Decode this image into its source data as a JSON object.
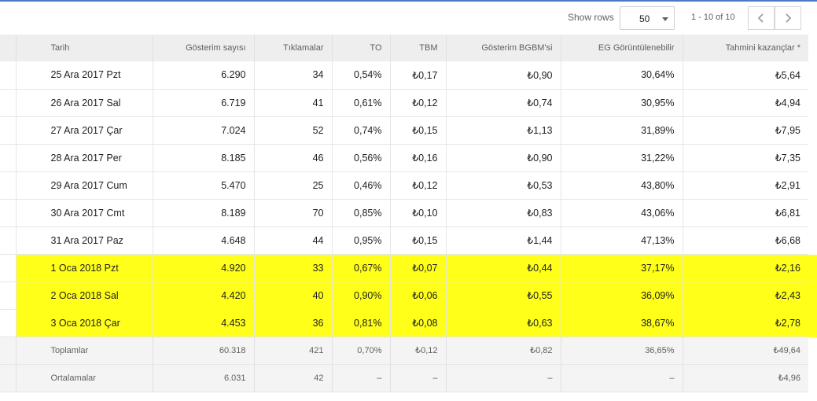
{
  "toolbar": {
    "show_rows_label": "Show rows",
    "rows_value": "50",
    "page_info": "1 - 10 of 10",
    "prev_icon": "chevron-left-icon",
    "next_icon": "chevron-right-icon"
  },
  "table": {
    "headers": [
      "Tarih",
      "Gösterim sayısı",
      "Tıklamalar",
      "TO",
      "TBM",
      "Gösterim BGBM'si",
      "EG Görüntülenebilir",
      "Tahmini kazançlar *"
    ],
    "rows": [
      {
        "date": "25 Ara 2017 Pzt",
        "impressions": "6.290",
        "clicks": "34",
        "ctr": "0,54%",
        "cpc": "₺0,17",
        "rpm": "₺0,90",
        "viewable": "30,64%",
        "earnings": "₺5,64",
        "highlight": false
      },
      {
        "date": "26 Ara 2017 Sal",
        "impressions": "6.719",
        "clicks": "41",
        "ctr": "0,61%",
        "cpc": "₺0,12",
        "rpm": "₺0,74",
        "viewable": "30,95%",
        "earnings": "₺4,94",
        "highlight": false
      },
      {
        "date": "27 Ara 2017 Çar",
        "impressions": "7.024",
        "clicks": "52",
        "ctr": "0,74%",
        "cpc": "₺0,15",
        "rpm": "₺1,13",
        "viewable": "31,89%",
        "earnings": "₺7,95",
        "highlight": false
      },
      {
        "date": "28 Ara 2017 Per",
        "impressions": "8.185",
        "clicks": "46",
        "ctr": "0,56%",
        "cpc": "₺0,16",
        "rpm": "₺0,90",
        "viewable": "31,22%",
        "earnings": "₺7,35",
        "highlight": false
      },
      {
        "date": "29 Ara 2017 Cum",
        "impressions": "5.470",
        "clicks": "25",
        "ctr": "0,46%",
        "cpc": "₺0,12",
        "rpm": "₺0,53",
        "viewable": "43,80%",
        "earnings": "₺2,91",
        "highlight": false
      },
      {
        "date": "30 Ara 2017 Cmt",
        "impressions": "8.189",
        "clicks": "70",
        "ctr": "0,85%",
        "cpc": "₺0,10",
        "rpm": "₺0,83",
        "viewable": "43,06%",
        "earnings": "₺6,81",
        "highlight": false
      },
      {
        "date": "31 Ara 2017 Paz",
        "impressions": "4.648",
        "clicks": "44",
        "ctr": "0,95%",
        "cpc": "₺0,15",
        "rpm": "₺1,44",
        "viewable": "47,13%",
        "earnings": "₺6,68",
        "highlight": false
      },
      {
        "date": "1 Oca 2018 Pzt",
        "impressions": "4.920",
        "clicks": "33",
        "ctr": "0,67%",
        "cpc": "₺0,07",
        "rpm": "₺0,44",
        "viewable": "37,17%",
        "earnings": "₺2,16",
        "highlight": true
      },
      {
        "date": "2 Oca 2018 Sal",
        "impressions": "4.420",
        "clicks": "40",
        "ctr": "0,90%",
        "cpc": "₺0,06",
        "rpm": "₺0,55",
        "viewable": "36,09%",
        "earnings": "₺2,43",
        "highlight": true
      },
      {
        "date": "3 Oca 2018 Çar",
        "impressions": "4.453",
        "clicks": "36",
        "ctr": "0,81%",
        "cpc": "₺0,08",
        "rpm": "₺0,63",
        "viewable": "38,67%",
        "earnings": "₺2,78",
        "highlight": true
      }
    ],
    "totals": {
      "label": "Toplamlar",
      "impressions": "60.318",
      "clicks": "421",
      "ctr": "0,70%",
      "cpc": "₺0,12",
      "rpm": "₺0,82",
      "viewable": "36,65%",
      "earnings": "₺49,64"
    },
    "averages": {
      "label": "Ortalamalar",
      "impressions": "6.031",
      "clicks": "42",
      "ctr": "–",
      "cpc": "–",
      "rpm": "–",
      "viewable": "–",
      "earnings": "₺4,96"
    }
  },
  "colors": {
    "highlight": "#ffff1a",
    "accent_line": "#4a79c9",
    "header_bg": "#eeeeee"
  }
}
